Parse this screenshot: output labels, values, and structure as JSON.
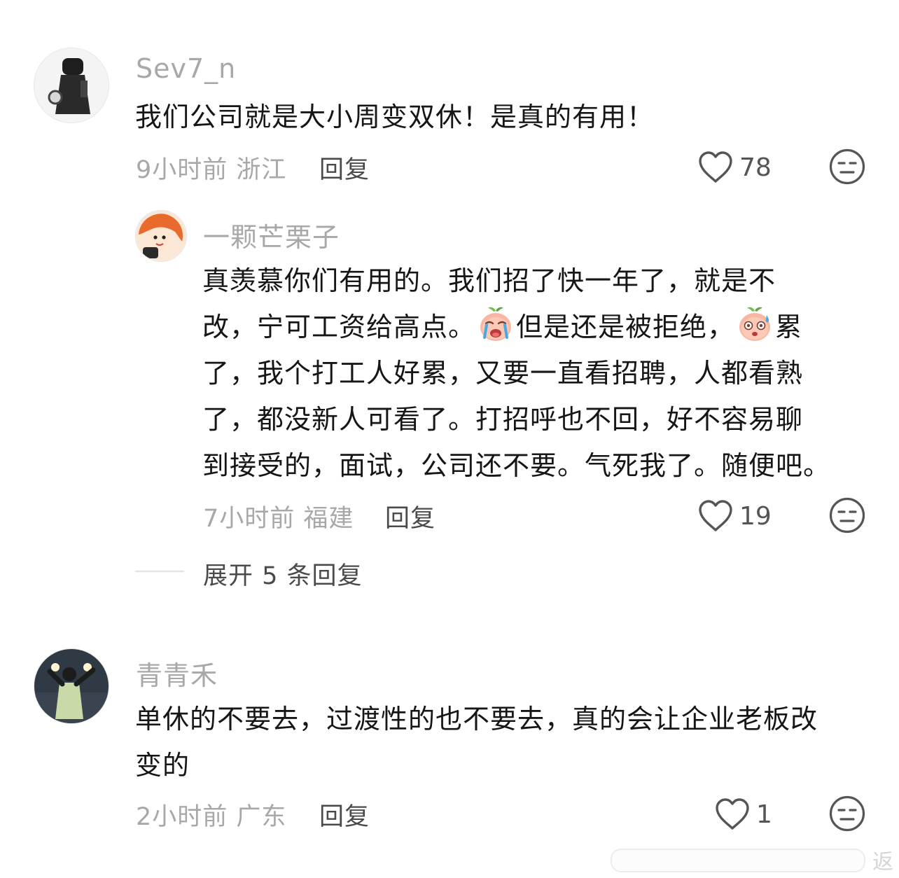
{
  "comments": [
    {
      "username": "Sev7_n",
      "content": [
        "我们公司就是大小周变双休！是真的有用！"
      ],
      "time": "9小时前",
      "location": "浙江",
      "reply_label": "回复",
      "likes": "78"
    },
    {
      "username": "一颗芒栗子",
      "content": [
        "真羡慕你们有用的。我们招了快一年了，就是不",
        {
          "before": "改，宁可工资给高点。",
          "emoji1": "crying-peach-emoji",
          "middle": "但是还是被拒绝，",
          "emoji2": "sweating-peach-emoji",
          "after": "累"
        },
        "了，我个打工人好累，又要一直看招聘，人都看熟",
        "了，都没新人可看了。打招呼也不回，好不容易聊",
        "到接受的，面试，公司还不要。气死我了。随便吧。"
      ],
      "time": "7小时前",
      "location": "福建",
      "reply_label": "回复",
      "likes": "19"
    },
    {
      "username": "青青禾",
      "content": [
        "单休的不要去，过渡性的也不要去，真的会让企业老板改",
        "变的"
      ],
      "time": "2小时前",
      "location": "广东",
      "reply_label": "回复",
      "likes": "1"
    }
  ],
  "expand_replies": "展开 5 条回复",
  "icons": {
    "like": "heart-outline-icon",
    "dislike": "neutral-face-icon"
  },
  "watermark": {
    "text": "返"
  },
  "colors": {
    "text": "#161616",
    "muted": "#a8a8a8",
    "action": "#4a4a4a",
    "icon": "#555555"
  }
}
